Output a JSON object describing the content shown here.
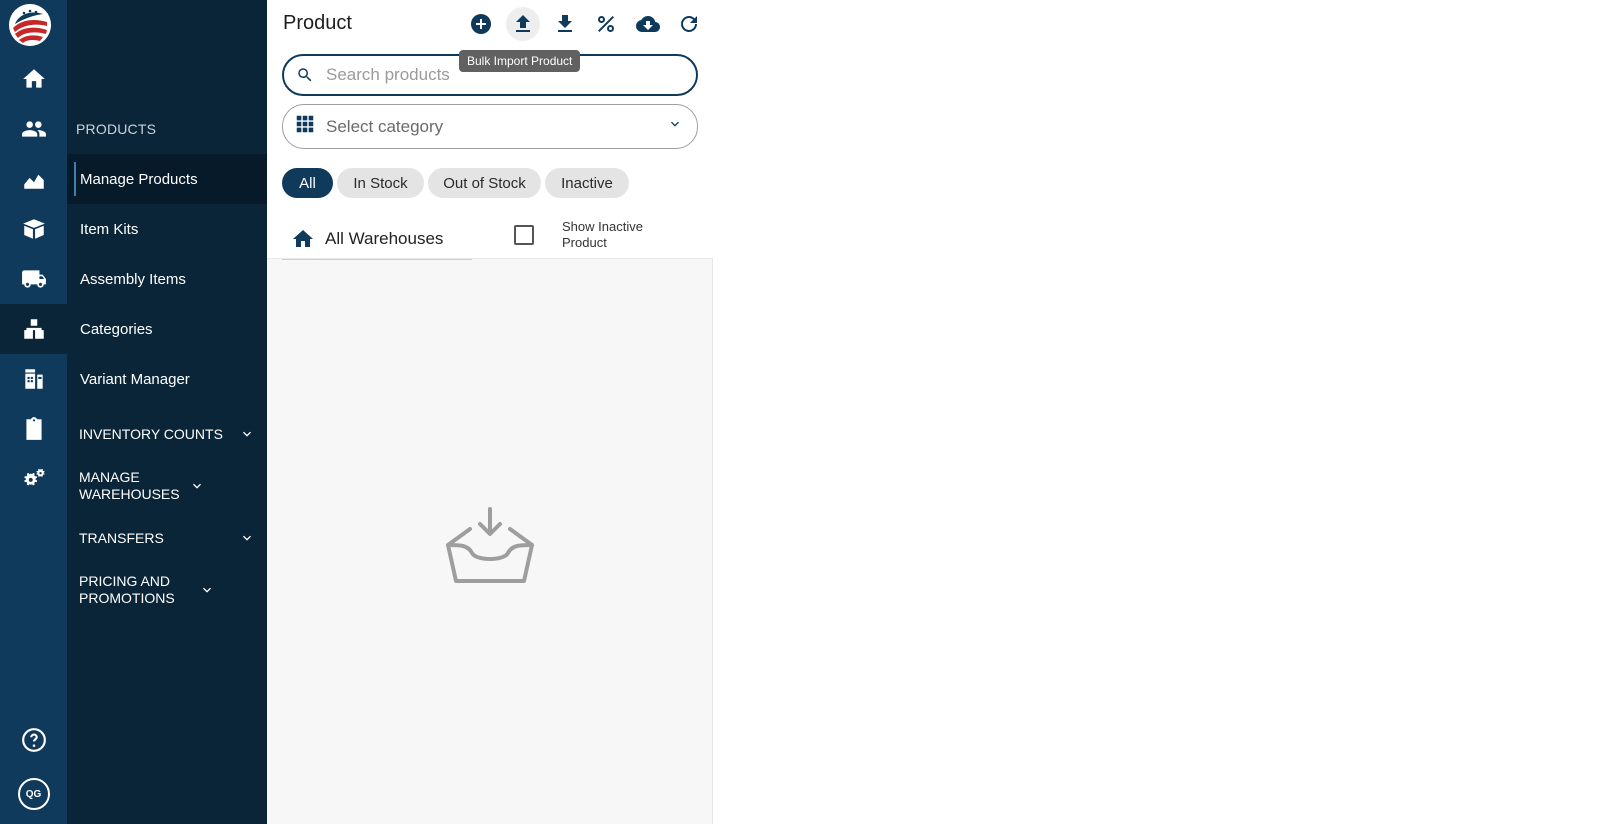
{
  "rail": {
    "items": [
      {
        "icon": "home-icon"
      },
      {
        "icon": "users-icon"
      },
      {
        "icon": "chart-icon"
      },
      {
        "icon": "box-icon"
      },
      {
        "icon": "truck-icon"
      },
      {
        "icon": "products-icon",
        "active": true
      },
      {
        "icon": "register-icon"
      },
      {
        "icon": "clipboard-icon"
      },
      {
        "icon": "settings-icon"
      }
    ],
    "help_icon": "help-icon",
    "avatar_initials": "QG"
  },
  "subnav": {
    "section_title": "PRODUCTS",
    "items": [
      {
        "label": "Manage Products",
        "active": true
      },
      {
        "label": "Item Kits"
      },
      {
        "label": "Assembly Items"
      },
      {
        "label": "Categories"
      },
      {
        "label": "Variant Manager"
      }
    ],
    "groups": [
      {
        "label": "INVENTORY COUNTS"
      },
      {
        "label": "MANAGE WAREHOUSES"
      },
      {
        "label": "TRANSFERS"
      },
      {
        "label": "PRICING AND PROMOTIONS"
      }
    ]
  },
  "panel": {
    "title": "Product",
    "toolbar": [
      "add-icon",
      "upload-icon",
      "download-icon",
      "percent-icon",
      "cloud-download-icon",
      "refresh-icon"
    ],
    "tooltip": "Bulk Import Product",
    "search_placeholder": "Search products",
    "category_placeholder": "Select category",
    "filters": [
      {
        "label": "All",
        "active": true
      },
      {
        "label": "In Stock"
      },
      {
        "label": "Out of Stock"
      },
      {
        "label": "Inactive"
      }
    ],
    "warehouse": "All Warehouses",
    "show_inactive_label": "Show Inactive Product",
    "show_inactive_checked": false
  },
  "colors": {
    "rail": "#0f3a5c",
    "subnav": "#0b2538",
    "accent": "#0f3a5c"
  }
}
